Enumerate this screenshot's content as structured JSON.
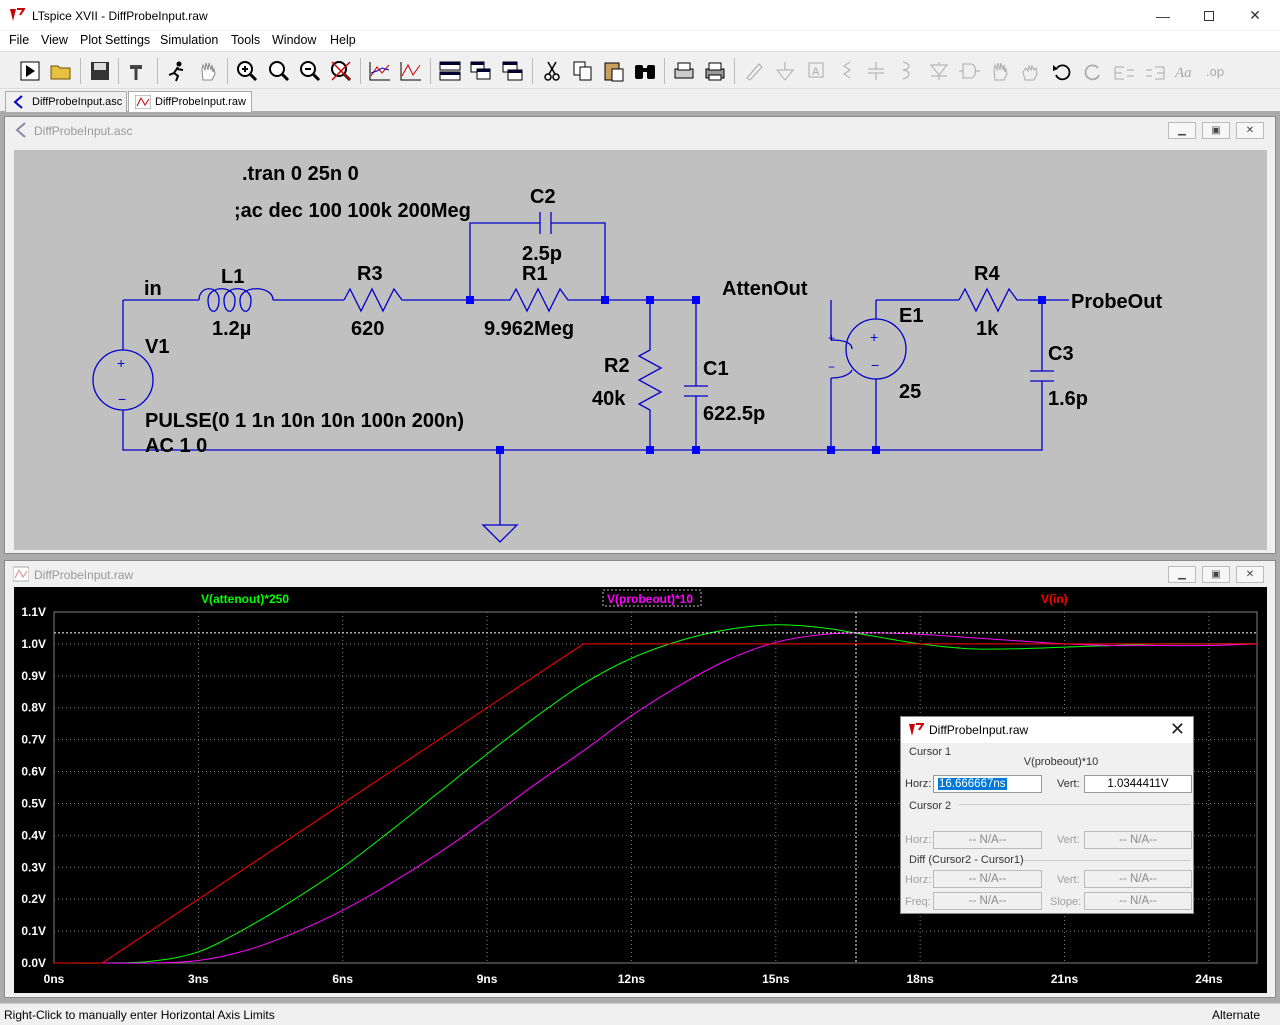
{
  "window": {
    "title": "LTspice XVII - DiffProbeInput.raw"
  },
  "menu": {
    "items": [
      "File",
      "View",
      "Plot Settings",
      "Simulation",
      "Tools",
      "Window",
      "Help"
    ]
  },
  "tabs": [
    {
      "label": "DiffProbeInput.asc"
    },
    {
      "label": "DiffProbeInput.raw"
    }
  ],
  "schematic": {
    "title": "DiffProbeInput.asc",
    "directives": [
      ".tran 0 25n 0",
      ";ac dec 100 100k 200Meg"
    ],
    "components": [
      {
        "ref": "V1",
        "value1": "PULSE(0 1 1n 10n 10n 100n 200n)",
        "value2": "AC 1 0"
      },
      {
        "ref": "L1",
        "value": "1.2µ"
      },
      {
        "ref": "R3",
        "value": "620"
      },
      {
        "ref": "C2",
        "value": "2.5p"
      },
      {
        "ref": "R1",
        "value": "9.962Meg"
      },
      {
        "ref": "R2",
        "value": "40k"
      },
      {
        "ref": "C1",
        "value": "622.5p"
      },
      {
        "ref": "E1",
        "value": "25"
      },
      {
        "ref": "R4",
        "value": "1k"
      },
      {
        "ref": "C3",
        "value": "1.6p"
      }
    ],
    "nets": [
      "in",
      "AttenOut",
      "ProbeOut"
    ],
    "polarity": {
      "plus": "+",
      "minus": "−"
    }
  },
  "plot": {
    "title": "DiffProbeInput.raw",
    "colors": {
      "background": "#000000",
      "grid": "#808080",
      "attenout": "#00ff00",
      "probeout": "#ff00ff",
      "in": "#ff0000",
      "axis_text": "#ffffff"
    },
    "chart_data": {
      "type": "line",
      "xlabel": "",
      "ylabel": "",
      "xlim": [
        0,
        25
      ],
      "ylim": [
        0,
        1.1
      ],
      "x_ticks": [
        "0ns",
        "3ns",
        "6ns",
        "9ns",
        "12ns",
        "15ns",
        "18ns",
        "21ns",
        "24ns"
      ],
      "y_ticks": [
        "0.0V",
        "0.1V",
        "0.2V",
        "0.3V",
        "0.4V",
        "0.5V",
        "0.6V",
        "0.7V",
        "0.8V",
        "0.9V",
        "1.0V",
        "1.1V"
      ],
      "cursor": {
        "x": 16.666667,
        "y": 1.0344411
      },
      "series": [
        {
          "name": "V(attenout)*250",
          "color": "#00ff00",
          "x": [
            0,
            1,
            2,
            3,
            4,
            5,
            6,
            7,
            8,
            9,
            10,
            11,
            12,
            13,
            14,
            15,
            16,
            17,
            18,
            19,
            20,
            21,
            22,
            23,
            24,
            25
          ],
          "y": [
            0,
            0,
            0.005,
            0.035,
            0.11,
            0.2,
            0.3,
            0.415,
            0.535,
            0.655,
            0.77,
            0.875,
            0.955,
            1.01,
            1.045,
            1.06,
            1.05,
            1.025,
            1.0,
            0.985,
            0.985,
            0.99,
            0.995,
            1.0,
            1.0,
            1.0
          ]
        },
        {
          "name": "V(probeout)*10",
          "color": "#ff00ff",
          "x": [
            0,
            1,
            2,
            3,
            4,
            5,
            6,
            7,
            8,
            9,
            10,
            11,
            12,
            13,
            14,
            15,
            16,
            17,
            18,
            19,
            20,
            21,
            22,
            23,
            24,
            25
          ],
          "y": [
            0,
            0,
            0,
            0.008,
            0.04,
            0.095,
            0.165,
            0.25,
            0.345,
            0.45,
            0.56,
            0.665,
            0.775,
            0.87,
            0.95,
            1.005,
            1.03,
            1.035,
            1.03,
            1.02,
            1.01,
            1.0,
            0.995,
            0.995,
            0.995,
            1.0
          ]
        },
        {
          "name": "V(in)",
          "color": "#ff0000",
          "x": [
            0,
            1,
            11,
            25
          ],
          "y": [
            0,
            0,
            1,
            1
          ]
        }
      ]
    }
  },
  "cursor_dialog": {
    "title": "DiffProbeInput.raw",
    "cursor1_label": "Cursor 1",
    "trace": "V(probeout)*10",
    "horz_label": "Horz:",
    "vert_label": "Vert:",
    "horz_value": "16.666667ns",
    "vert_value": "1.0344411V",
    "cursor2_label": "Cursor 2",
    "na": "-- N/A--",
    "diff_label": "Diff (Cursor2 - Cursor1)",
    "freq_label": "Freq:",
    "slope_label": "Slope:"
  },
  "status": {
    "text": "Right-Click to manually enter Horizontal Axis Limits",
    "mode": "Alternate"
  }
}
